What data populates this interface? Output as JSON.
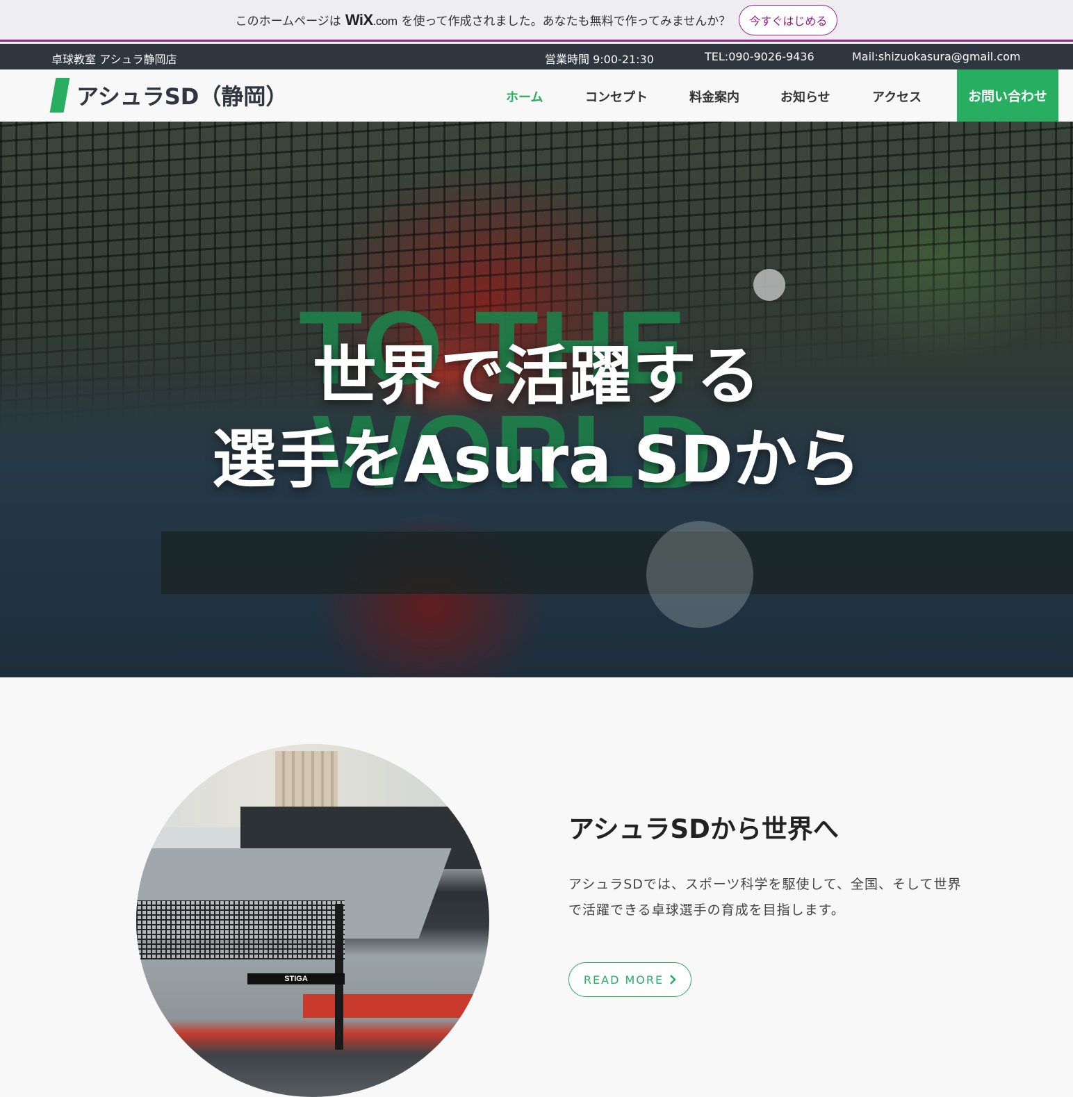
{
  "wix_banner": {
    "text_before": "このホームページは",
    "logo": "WiX",
    "logo_suffix": ".com",
    "text_after": "を使って作成されました。あなたも無料で作ってみませんか？",
    "cta_label": "今すぐはじめる"
  },
  "info_bar": {
    "shop_name": "卓球教室 アシュラ静岡店",
    "hours": "営業時間 9:00-21:30",
    "tel": "TEL:090-9026-9436",
    "mail": "Mail:shizuokasura@gmail.com"
  },
  "header": {
    "logo_text": "アシュラSD（静岡）",
    "nav": [
      {
        "label": "ホーム",
        "active": true
      },
      {
        "label": "コンセプト",
        "active": false
      },
      {
        "label": "料金案内",
        "active": false
      },
      {
        "label": "お知らせ",
        "active": false
      },
      {
        "label": "アクセス",
        "active": false
      }
    ],
    "contact_label": "お問い合わせ"
  },
  "hero": {
    "bg_word_top": "TO THE",
    "bg_word_bottom": "WORLD",
    "headline_line1": "世界で活躍する",
    "headline_line2": "選手をAsura SDから"
  },
  "about": {
    "title": "アシュラSDから世界へ",
    "body": "アシュラSDでは、スポーツ科学を駆使して、全国、そして世界で活躍できる卓球選手の育成を目指します。",
    "photo_brand": "STIGA",
    "read_more_label": "READ MORE",
    "read_more_icon": "chevron-right-icon"
  },
  "colors": {
    "accent": "#27ae60",
    "wix_purple": "#9b1c8b",
    "info_bar_bg": "#2f3640",
    "bg_word": "#1e7f4a"
  }
}
